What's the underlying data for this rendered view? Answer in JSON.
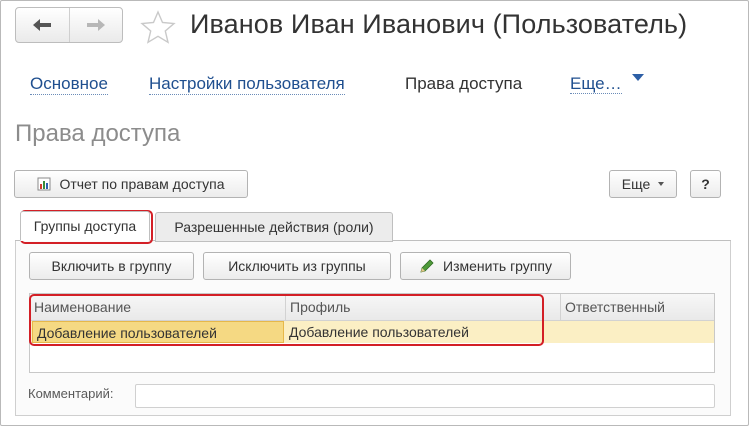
{
  "window": {
    "title": "Иванов Иван Иванович (Пользователь)"
  },
  "nav": {
    "back_icon": "arrow-left-icon",
    "forward_icon": "arrow-right-icon",
    "favorite_icon": "star-icon"
  },
  "toplinks": {
    "main": "Основное",
    "user_settings": "Настройки пользователя",
    "access_rights": "Права доступа",
    "more": "Еще…"
  },
  "section": {
    "title": "Права доступа"
  },
  "toolbar": {
    "report_label": "Отчет по правам доступа",
    "more_label": "Еще",
    "help_label": "?"
  },
  "tabs": {
    "groups": "Группы доступа",
    "roles": "Разрешенные действия (роли)"
  },
  "group_toolbar": {
    "include": "Включить в группу",
    "exclude": "Исключить из группы",
    "edit": "Изменить группу"
  },
  "table": {
    "columns": [
      "Наименование",
      "Профиль",
      "Ответственный"
    ],
    "rows": [
      [
        "Добавление пользователей",
        "Добавление пользователей",
        ""
      ]
    ]
  },
  "comment": {
    "label": "Комментарий:",
    "value": ""
  },
  "colors": {
    "link": "#1f4f8f",
    "highlight": "#d31f26",
    "selected_row": "#fbefc4"
  }
}
